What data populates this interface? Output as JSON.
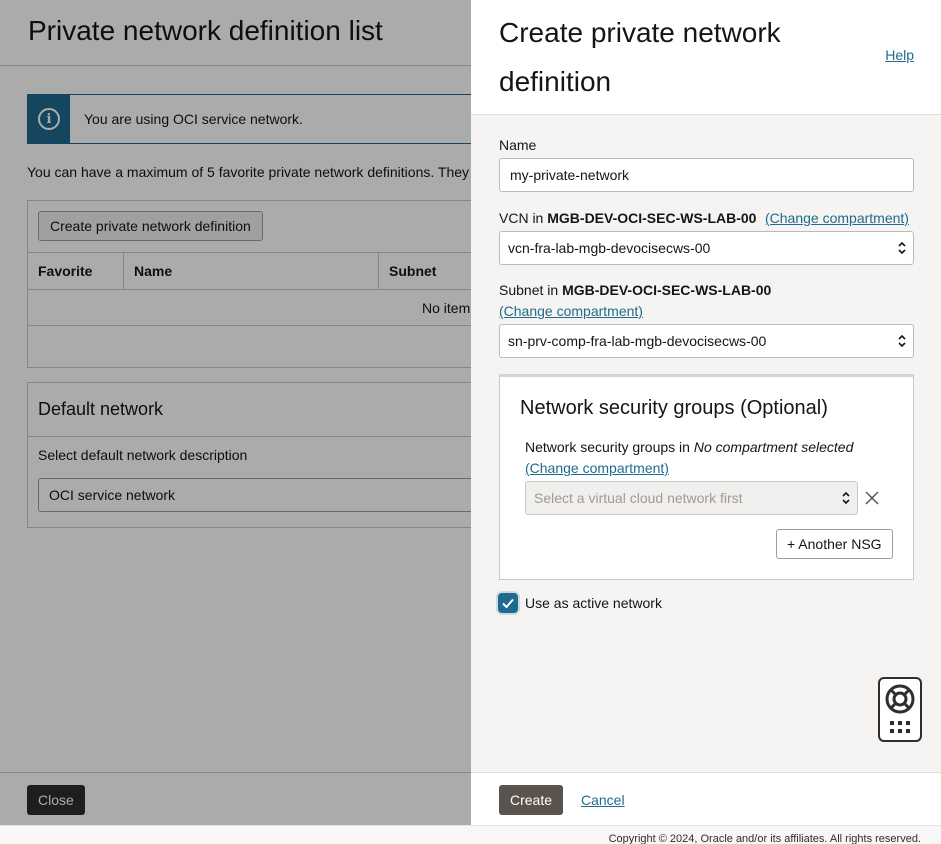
{
  "background": {
    "title": "Private network definition list",
    "banner_text": "You are using OCI service network.",
    "banner_icon": "info-icon",
    "note": "You can have a maximum of 5 favorite private network definitions. They",
    "create_button": "Create private network definition",
    "table": {
      "columns": [
        "Favorite",
        "Name",
        "Subnet"
      ],
      "empty_text": "No item"
    },
    "default_network": {
      "title": "Default network",
      "label": "Select default network description",
      "value": "OCI service network"
    },
    "close_button": "Close"
  },
  "drawer": {
    "title": "Create private network definition",
    "help_link": "Help",
    "name_label": "Name",
    "name_value": "my-private-network",
    "vcn_label_prefix": "VCN in",
    "vcn_compartment": "MGB-DEV-OCI-SEC-WS-LAB-00",
    "vcn_change_link": "(Change compartment)",
    "vcn_value": "vcn-fra-lab-mgb-devocisecws-00",
    "subnet_label_prefix": "Subnet in",
    "subnet_compartment": "MGB-DEV-OCI-SEC-WS-LAB-00",
    "subnet_change_link": "(Change compartment)",
    "subnet_value": "sn-prv-comp-fra-lab-mgb-devocisecws-00",
    "nsg": {
      "title": "Network security groups (Optional)",
      "label_prefix": "Network security groups in",
      "compartment": "No compartment selected",
      "change_link": "(Change compartment)",
      "placeholder": "Select a virtual cloud network first",
      "another_button": "+ Another NSG"
    },
    "active_network_label": "Use as active network",
    "active_network_checked": true,
    "create_button": "Create",
    "cancel_link": "Cancel"
  },
  "footer": {
    "copyright": "Copyright © 2024, Oracle and/or its affiliates. All rights reserved."
  },
  "colors": {
    "accent": "#1f6b8e",
    "primary_button": "#5b534d",
    "text": "#161513"
  }
}
